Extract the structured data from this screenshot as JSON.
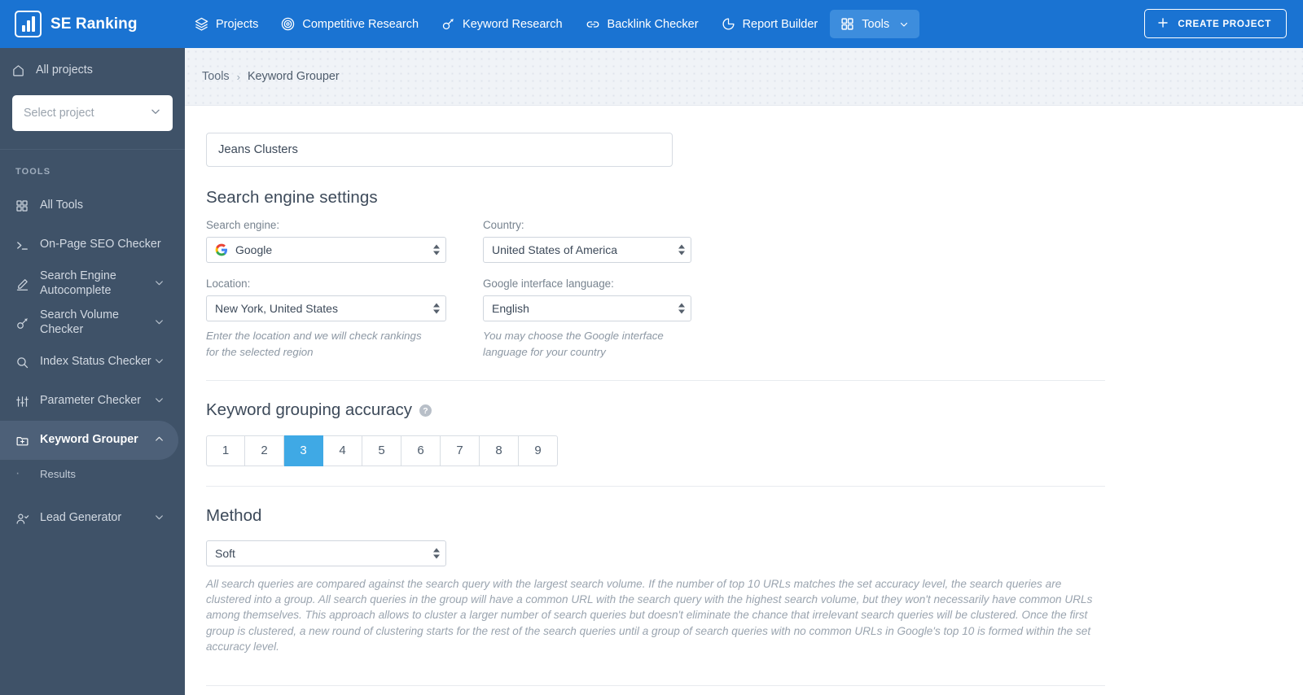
{
  "topbar": {
    "brand": "SE Ranking",
    "nav": [
      {
        "label": "Projects",
        "icon": "layers-icon",
        "active": false
      },
      {
        "label": "Competitive Research",
        "icon": "target-icon",
        "active": false
      },
      {
        "label": "Keyword Research",
        "icon": "key-icon",
        "active": false
      },
      {
        "label": "Backlink Checker",
        "icon": "link-icon",
        "active": false
      },
      {
        "label": "Report Builder",
        "icon": "pie-chart-icon",
        "active": false
      },
      {
        "label": "Tools",
        "icon": "grid-icon",
        "active": true
      }
    ],
    "create_project_label": "CREATE PROJECT",
    "brand_blue": "#1a73d2",
    "nav_active_blue": "#3d8ddd"
  },
  "sidebar": {
    "all_projects_label": "All projects",
    "project_select_placeholder": "Select project",
    "section_label": "TOOLS",
    "items": [
      {
        "label": "All Tools",
        "icon": "grid-icon",
        "caret": false,
        "active": false
      },
      {
        "label": "On-Page SEO Checker",
        "icon": "terminal-icon",
        "caret": false,
        "active": false
      },
      {
        "label": "Search Engine Autocomplete",
        "icon": "pen-icon",
        "caret": true,
        "active": false
      },
      {
        "label": "Search Volume Checker",
        "icon": "key-icon",
        "caret": true,
        "active": false
      },
      {
        "label": "Index Status Checker",
        "icon": "search-icon",
        "caret": true,
        "active": false
      },
      {
        "label": "Parameter Checker",
        "icon": "sliders-icon",
        "caret": true,
        "active": false
      },
      {
        "label": "Keyword Grouper",
        "icon": "folder-plus-icon",
        "caret": true,
        "active": true
      }
    ],
    "sub_item": "Results",
    "last_item": {
      "label": "Lead Generator",
      "icon": "user-check-icon",
      "caret": true
    },
    "bg": "#3f5268",
    "active_bg": "#4d6078"
  },
  "breadcrumb": {
    "parent": "Tools",
    "separator": "›",
    "current": "Keyword Grouper"
  },
  "form": {
    "title_value": "Jeans Clusters",
    "title_placeholder": "Jeans Clusters",
    "search_engine_settings_heading": "Search engine settings",
    "search_engine_label": "Search engine:",
    "search_engine_value": "Google",
    "country_label": "Country:",
    "country_value": "United States of America",
    "location_label": "Location:",
    "location_value": "New York, United States",
    "location_hint": "Enter the location and we will check rankings for the selected region",
    "language_label": "Google interface language:",
    "language_value": "English",
    "language_hint": "You may choose the Google interface language for your country",
    "accuracy_heading": "Keyword grouping accuracy",
    "accuracy_help": "?",
    "accuracy_options": [
      "1",
      "2",
      "3",
      "4",
      "5",
      "6",
      "7",
      "8",
      "9"
    ],
    "accuracy_selected": "3",
    "accuracy_active_color": "#3fa9e5",
    "method_heading": "Method",
    "method_value": "Soft",
    "method_description": "All search queries are compared against the search query with the largest search volume. If the number of top 10 URLs matches the set accuracy level, the search queries are clustered into a group. All search queries in the group will have a common URL with the search query with the highest search volume, but they won't necessarily have common URLs among themselves. This approach allows to cluster a larger number of search queries but doesn't eliminate the chance that irrelevant search queries will be clustered. Once the first group is clustered, a new round of clustering starts for the rest of the search queries until a group of search queries with no common URLs in Google's top 10 is formed within the set accuracy level."
  }
}
